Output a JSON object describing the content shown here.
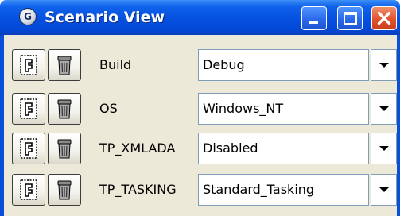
{
  "window": {
    "title": "Scenario View",
    "icon": "gps-app-icon",
    "icon_glyph": "G",
    "title_bar_color": "#0550e0",
    "close_button_color": "#e0532c"
  },
  "scenario": {
    "rows": [
      {
        "variable": "Build",
        "value": "Debug"
      },
      {
        "variable": "OS",
        "value": "Windows_NT"
      },
      {
        "variable": "TP_XMLADA",
        "value": "Disabled"
      },
      {
        "variable": "TP_TASKING",
        "value": "Standard_Tasking"
      }
    ],
    "edit_icon": "edit-variable-icon",
    "delete_icon": "trash-can-icon",
    "dropdown_icon": "dropdown-arrow-icon"
  }
}
